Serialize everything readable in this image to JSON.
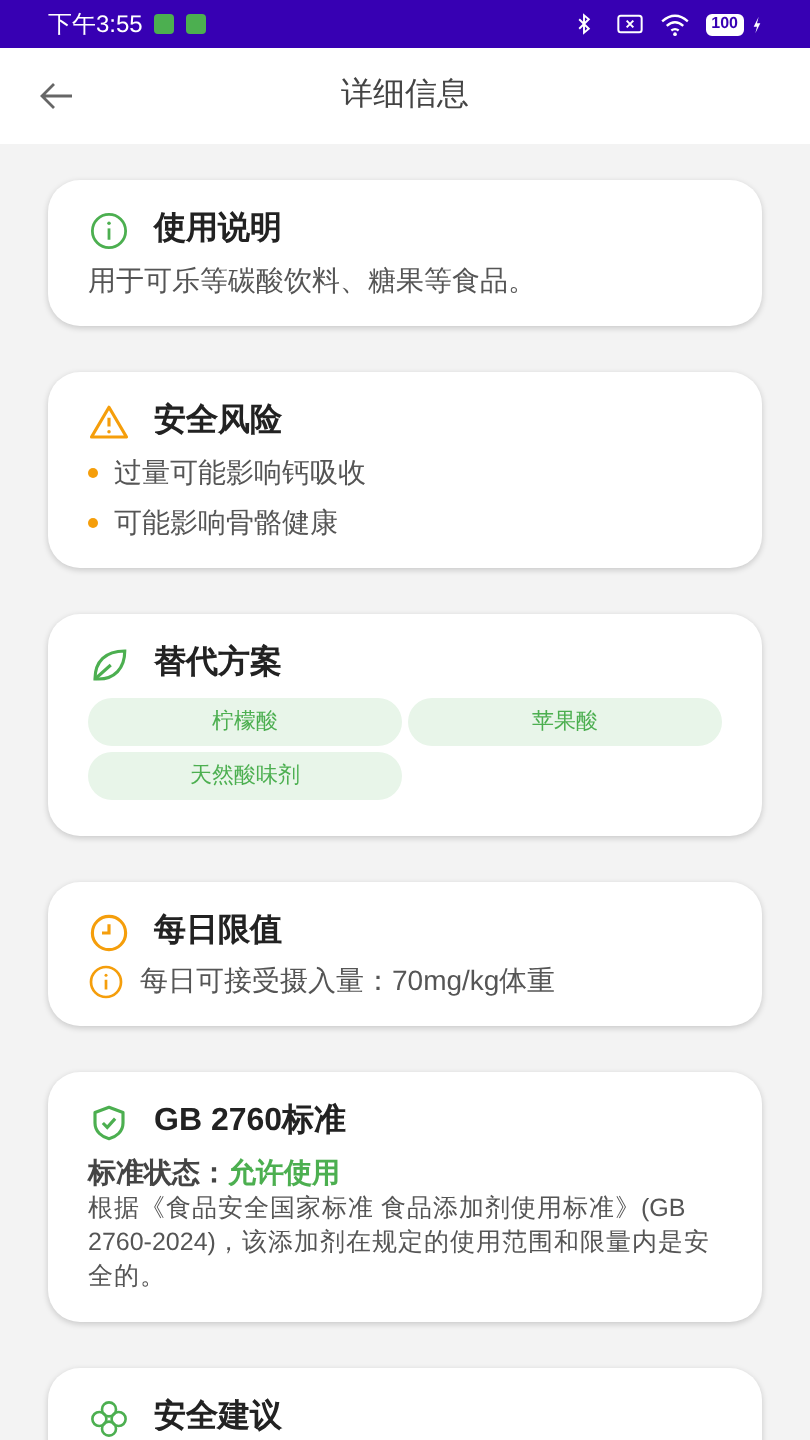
{
  "status_bar": {
    "time": "下午3:55",
    "battery": "100"
  },
  "header": {
    "title": "详细信息"
  },
  "cards": [
    {
      "kind": "text",
      "title": "使用说明",
      "text": "用于可乐等碳酸饮料、糖果等食品。"
    },
    {
      "kind": "bullets",
      "title": "安全风险",
      "items": [
        "过量可能影响钙吸收",
        "可能影响骨骼健康"
      ]
    },
    {
      "kind": "chips",
      "title": "替代方案",
      "chips": [
        "柠檬酸",
        "苹果酸",
        "天然酸味剂"
      ]
    },
    {
      "kind": "limit",
      "title": "每日限值",
      "text": "每日可接受摄入量：70mg/kg体重"
    },
    {
      "kind": "standard",
      "title": "GB 2760标准",
      "status_label": "标准状态：",
      "status_value": "允许使用",
      "text": "根据《食品安全国家标准 食品添加剂使用标准》(GB 2760-2024)，该添加剂在规定的使用范围和限量内是安全的。"
    },
    {
      "kind": "title_only",
      "title": "安全建议"
    }
  ]
}
